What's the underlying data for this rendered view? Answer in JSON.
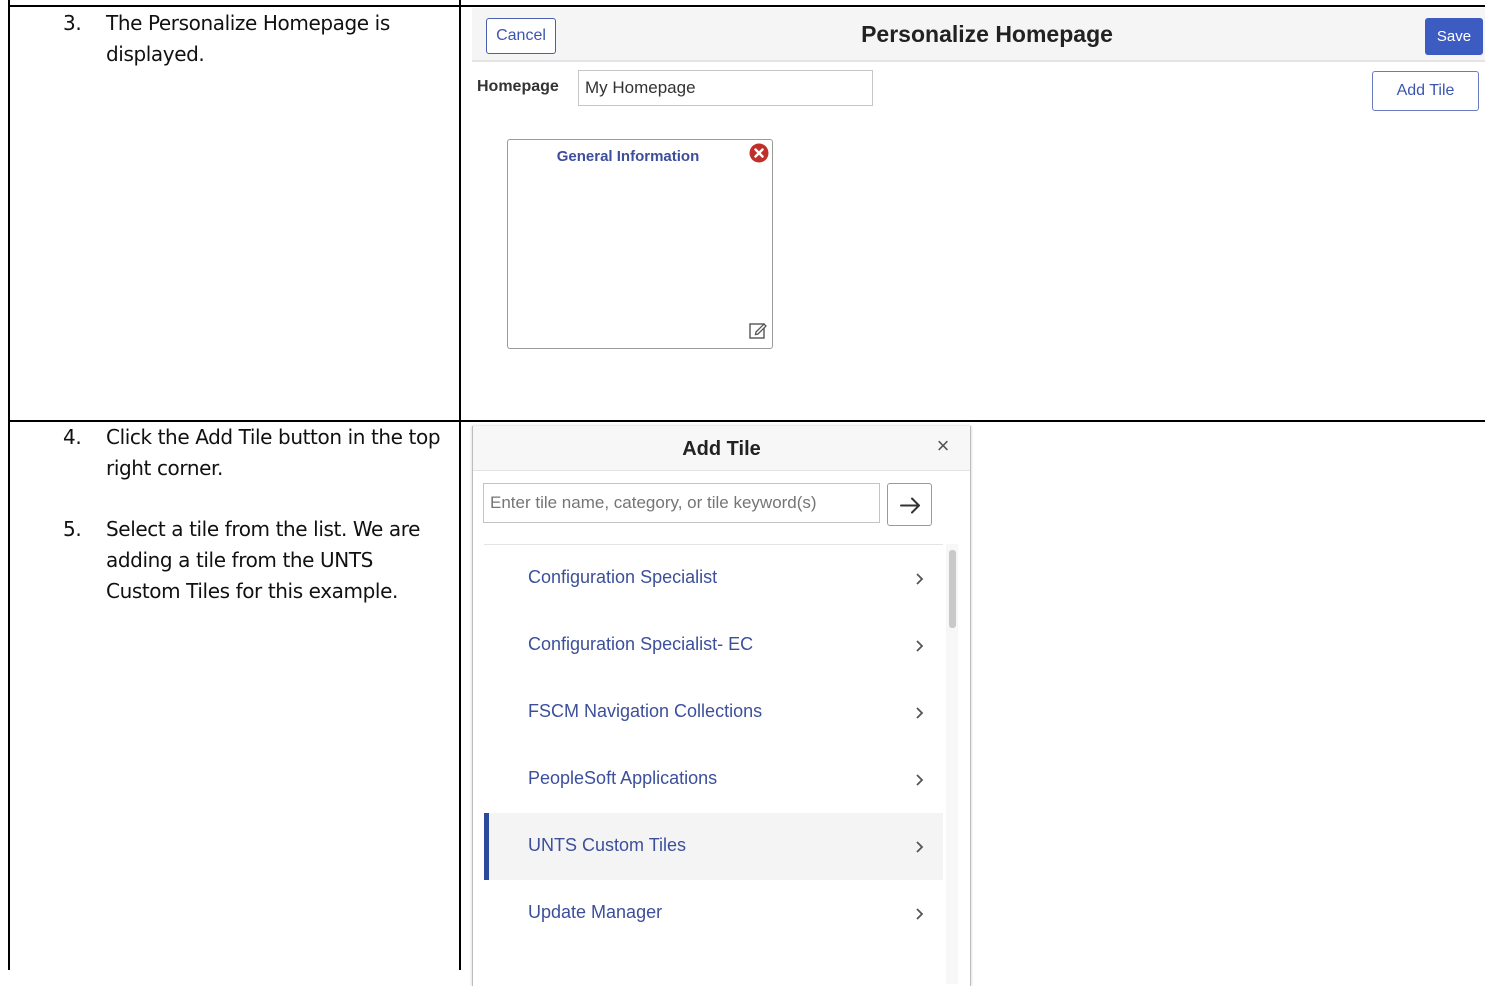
{
  "steps": [
    {
      "num": "3.",
      "text": "The Personalize Homepage is displayed."
    },
    {
      "num": "4.",
      "text": "Click the Add Tile button in the top right corner."
    },
    {
      "num": "5.",
      "text": "Select a tile from the list. We are adding a tile from the UNTS Custom Tiles for this example."
    }
  ],
  "personalize": {
    "cancel_label": "Cancel",
    "title": "Personalize Homepage",
    "save_label": "Save",
    "homepage_label": "Homepage",
    "homepage_value": "My Homepage",
    "add_tile_label": "Add Tile",
    "tile": {
      "title": "General Information",
      "close_icon": "remove-circle-icon",
      "edit_icon": "edit-icon"
    }
  },
  "add_tile_dialog": {
    "title": "Add Tile",
    "close_glyph": "×",
    "search_placeholder": "Enter tile name, category, or tile keyword(s)",
    "go_icon": "arrow-right-icon",
    "items": [
      {
        "label": "Configuration Specialist",
        "selected": false
      },
      {
        "label": "Configuration Specialist- EC",
        "selected": false
      },
      {
        "label": "FSCM Navigation Collections",
        "selected": false
      },
      {
        "label": "PeopleSoft Applications",
        "selected": false
      },
      {
        "label": "UNTS Custom Tiles",
        "selected": true
      },
      {
        "label": "Update Manager",
        "selected": false
      }
    ]
  },
  "colors": {
    "accent": "#3d5cc2",
    "link": "#3c4f9a",
    "close_red": "#c0302b"
  }
}
